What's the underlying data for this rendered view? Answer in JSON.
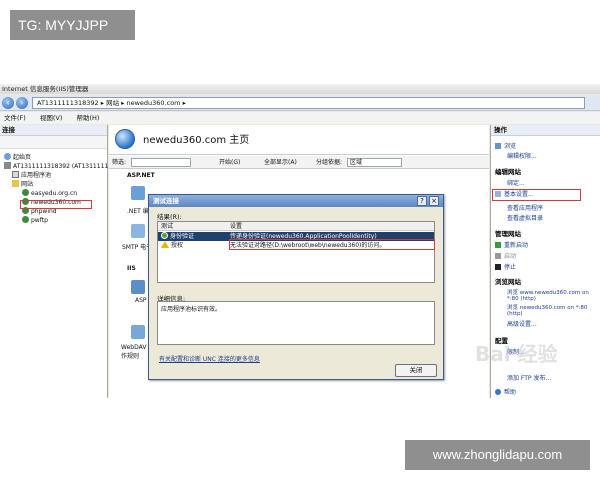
{
  "watermarks": {
    "top_left": "TG: MYYJJPP",
    "bottom_right": "www.zhonglidapu.com"
  },
  "window": {
    "title": "Internet 信息服务(IIS)管理器",
    "address": "AT1311111318392 ▸ 网站 ▸ newedu360.com ▸",
    "menu": [
      "文件(F)",
      "视图(V)",
      "帮助(H)"
    ]
  },
  "left_pane": {
    "header": "连接",
    "tree": [
      {
        "label": "起始页",
        "indent": 0
      },
      {
        "label": "AT1311111318392 (AT1311111",
        "indent": 0
      },
      {
        "label": "应用程序池",
        "indent": 1
      },
      {
        "label": "网站",
        "indent": 1
      },
      {
        "label": "easyedu.org.cn",
        "indent": 2
      },
      {
        "label": "newedu360.com",
        "indent": 2
      },
      {
        "label": "phpwind",
        "indent": 2
      },
      {
        "label": "pwftp",
        "indent": 2
      }
    ]
  },
  "center": {
    "page_title": "newedu360.com 主页",
    "filter_label": "筛选:",
    "start_label": "开始(G)",
    "show_all_label": "全部显示(A)",
    "group_label": "分组依据:",
    "group_value": "区域",
    "groups": [
      "ASP.NET",
      "IIS"
    ],
    "features": [
      ".NET 编",
      "SMTP 电子",
      "ASP",
      "WebDAV 创作规则"
    ]
  },
  "right_pane": {
    "header": "操作",
    "items": [
      {
        "label": "浏览",
        "type": "link"
      },
      {
        "label": "编辑权限...",
        "type": "link"
      },
      {
        "label": "编辑网站",
        "type": "section"
      },
      {
        "label": "绑定...",
        "type": "link"
      },
      {
        "label": "基本设置...",
        "type": "link"
      },
      {
        "label": "查看应用程序",
        "type": "link"
      },
      {
        "label": "查看虚拟目录",
        "type": "link"
      },
      {
        "label": "管理网站",
        "type": "section"
      },
      {
        "label": "重新启动",
        "type": "link"
      },
      {
        "label": "启动",
        "type": "link"
      },
      {
        "label": "停止",
        "type": "link"
      },
      {
        "label": "浏览网站",
        "type": "section"
      },
      {
        "label": "浏览 www.newedu360.com on *:80 (http)",
        "type": "link"
      },
      {
        "label": "浏览 newedu360.com on *:80 (http)",
        "type": "link"
      },
      {
        "label": "高级设置...",
        "type": "link"
      },
      {
        "label": "配置",
        "type": "section"
      },
      {
        "label": "限制...",
        "type": "link"
      },
      {
        "label": "添加 FTP 发布...",
        "type": "link"
      },
      {
        "label": "帮助",
        "type": "link"
      }
    ]
  },
  "dialog": {
    "title": "测试连接",
    "help_btn": "?",
    "close_btn": "×",
    "results_label": "结果(R):",
    "col_test": "测试",
    "col_setting": "设置",
    "rows": [
      {
        "test": "身份验证",
        "setting": "传递身份验证(newedu360.ApplicationPoolIdentity)",
        "status": "ok"
      },
      {
        "test": "授权",
        "setting": "无法验证对路径(D:\\webroot\\web\\newedu360)的访问。",
        "status": "warn"
      }
    ],
    "details_label": "详细信息:",
    "details_text": "应用程序池标识有效。",
    "link": "有关配置和诊断 UNC 连接的更多信息",
    "close_label": "关闭"
  },
  "baidu_watermark": "Bai 经验"
}
